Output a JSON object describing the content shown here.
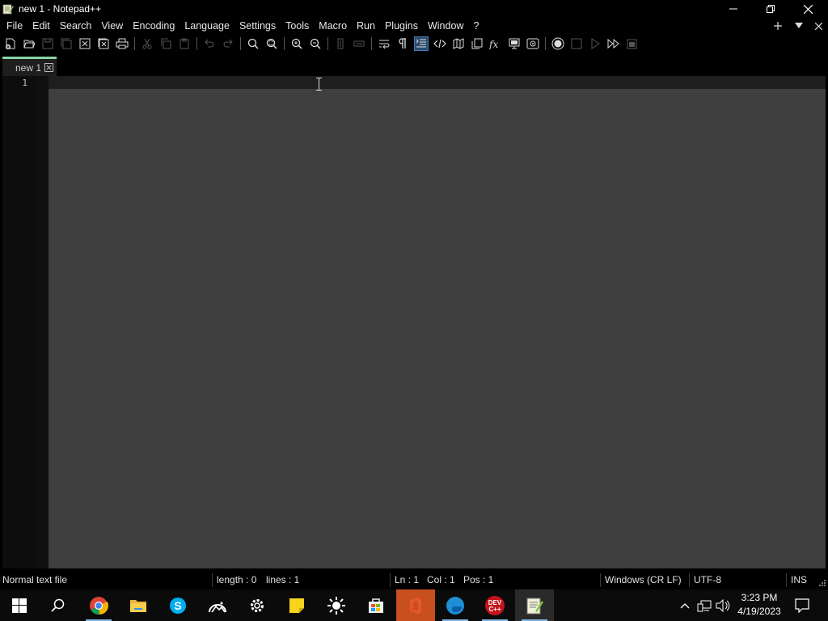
{
  "window": {
    "title": "new 1 - Notepad++",
    "controls": {
      "minimize": "minimize",
      "maximize": "restore",
      "close": "close"
    }
  },
  "menu": {
    "items": [
      "File",
      "Edit",
      "Search",
      "View",
      "Encoding",
      "Language",
      "Settings",
      "Tools",
      "Macro",
      "Run",
      "Plugins",
      "Window",
      "?"
    ],
    "right_icons": [
      "plus-icon",
      "dropdown-arrow-icon",
      "close-icon"
    ]
  },
  "toolbar": {
    "buttons": [
      "new-file",
      "open-file",
      "save",
      "save-all",
      "close",
      "close-all",
      "print",
      "cut",
      "copy",
      "paste",
      "undo",
      "redo",
      "find",
      "replace",
      "zoom-in",
      "zoom-out",
      "sync-vertical-scroll",
      "sync-horizontal-scroll",
      "word-wrap",
      "show-all-characters",
      "indent-guide",
      "user-defined-language",
      "document-map",
      "document-list",
      "function-list",
      "folder-as-workspace",
      "monitoring",
      "start-recording",
      "stop-recording",
      "playback",
      "run-macro-multiple",
      "save-recorded-macro"
    ]
  },
  "tabs": [
    {
      "label": "new 1",
      "active": true
    }
  ],
  "editor": {
    "line_numbers": [
      "1"
    ],
    "content": ""
  },
  "status": {
    "file_type": "Normal text file",
    "length": "length : 0",
    "lines": "lines : 1",
    "ln": "Ln : 1",
    "col": "Col : 1",
    "pos": "Pos : 1",
    "eol": "Windows (CR LF)",
    "encoding": "UTF-8",
    "mode": "INS"
  },
  "taskbar": {
    "apps": [
      "start-icon",
      "search-icon",
      "chrome-icon",
      "file-explorer-icon",
      "skype-icon",
      "photos-icon",
      "settings-icon",
      "sticky-notes-icon",
      "brightness-icon",
      "microsoft-store-icon",
      "office-icon",
      "edge-icon",
      "dev-cpp-icon",
      "notepad-plus-plus-icon"
    ],
    "dev_label": "DEV",
    "cpp_label": "C++",
    "time": "3:23 PM",
    "date": "4/19/2023"
  },
  "colors": {
    "editor_bg": "#3f3f3f",
    "current_line": "#1e1e1e",
    "tab_accent": "#89d3a6",
    "taskbar_highlight": "#c8501e"
  }
}
